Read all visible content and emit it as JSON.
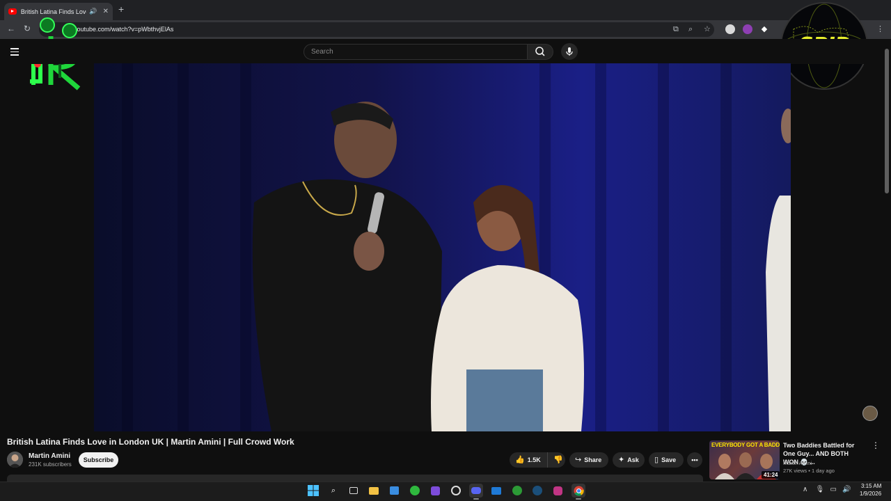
{
  "browser": {
    "tab_title": "British Latina Finds Love in",
    "tab_audio_icon": "speaker-icon",
    "tab_close": "✕",
    "new_tab": "+",
    "url": "youtube.com/watch?v=pWbthvjElAs"
  },
  "logos": {
    "right_logo_text": "SPIR"
  },
  "youtube": {
    "search_placeholder": "Search"
  },
  "video": {
    "title": "British Latina Finds Love in London UK | Martin Amini | Full Crowd Work",
    "channel_name": "Martin Amini",
    "subscribers": "231K subscribers",
    "subscribe_label": "Subscribe",
    "likes": "1.5K",
    "share_label": "Share",
    "ask_label": "Ask",
    "save_label": "Save"
  },
  "recommendation": {
    "thumb_text": "EVERYBODY GOT A BADDIE",
    "duration": "41:24",
    "title": "Two Baddies Battled for One Guy... AND BOTH WON 💀 ...",
    "channel": "Martin Amini",
    "meta": "27K views • 1 day ago"
  },
  "taskbar": {
    "time": "3:15 AM",
    "date": "1/9/2026"
  }
}
